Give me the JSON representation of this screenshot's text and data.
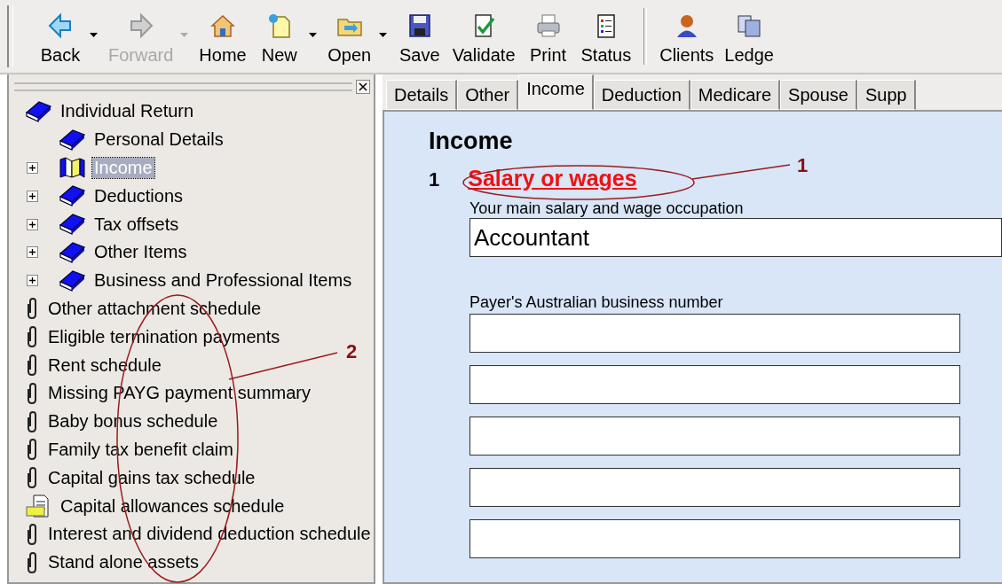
{
  "toolbar": [
    {
      "label": "Back",
      "disabled": false,
      "dropdown": true
    },
    {
      "label": "Forward",
      "disabled": true,
      "dropdown": true
    },
    {
      "label": "Home",
      "disabled": false,
      "dropdown": false
    },
    {
      "label": "New",
      "disabled": false,
      "dropdown": true
    },
    {
      "label": "Open",
      "disabled": false,
      "dropdown": true
    },
    {
      "label": "Save",
      "disabled": false,
      "dropdown": false
    },
    {
      "label": "Validate",
      "disabled": false,
      "dropdown": false
    },
    {
      "label": "Print",
      "disabled": false,
      "dropdown": false
    },
    {
      "label": "Status",
      "disabled": false,
      "dropdown": false,
      "separator_after": true
    },
    {
      "label": "Clients",
      "disabled": false,
      "dropdown": false
    },
    {
      "label": "Ledge",
      "disabled": false,
      "dropdown": false
    }
  ],
  "tree": [
    {
      "label": "Individual Return",
      "kind": "book",
      "selected": false,
      "expandable": false,
      "children": [
        {
          "label": "Personal Details",
          "kind": "book",
          "selected": false,
          "expandable": false
        },
        {
          "label": "Income",
          "kind": "open-book",
          "selected": true,
          "expandable": true
        },
        {
          "label": "Deductions",
          "kind": "book",
          "selected": false,
          "expandable": true
        },
        {
          "label": "Tax offsets",
          "kind": "book",
          "selected": false,
          "expandable": true
        },
        {
          "label": "Other Items",
          "kind": "book",
          "selected": false,
          "expandable": true
        },
        {
          "label": "Business and Professional Items",
          "kind": "book",
          "selected": false,
          "expandable": true
        }
      ]
    },
    {
      "label": "Other attachment schedule",
      "kind": "clip",
      "selected": false,
      "expandable": false
    },
    {
      "label": "Eligible termination payments",
      "kind": "clip",
      "selected": false,
      "expandable": false
    },
    {
      "label": "Rent schedule",
      "kind": "clip",
      "selected": false,
      "expandable": false
    },
    {
      "label": "Missing PAYG payment summary",
      "kind": "clip",
      "selected": false,
      "expandable": false
    },
    {
      "label": "Baby bonus schedule",
      "kind": "clip",
      "selected": false,
      "expandable": false
    },
    {
      "label": "Family tax benefit claim",
      "kind": "clip",
      "selected": false,
      "expandable": false
    },
    {
      "label": "Capital gains tax schedule",
      "kind": "clip",
      "selected": false,
      "expandable": false
    },
    {
      "label": "Capital allowances schedule",
      "kind": "document",
      "selected": false,
      "expandable": false
    },
    {
      "label": "Interest and dividend deduction schedule",
      "kind": "clip",
      "selected": false,
      "expandable": false
    },
    {
      "label": "Stand alone assets",
      "kind": "clip",
      "selected": false,
      "expandable": false
    }
  ],
  "tabs": [
    {
      "label": "Details",
      "selected": false
    },
    {
      "label": "Other",
      "selected": false
    },
    {
      "label": "Income",
      "selected": true
    },
    {
      "label": "Deduction",
      "selected": false
    },
    {
      "label": "Medicare",
      "selected": false
    },
    {
      "label": "Spouse",
      "selected": false
    },
    {
      "label": "Supp",
      "selected": false
    }
  ],
  "form": {
    "heading": "Income",
    "question_number": "1",
    "question_link": "Salary or wages",
    "occupation_label": "Your main salary and wage occupation",
    "occupation_value": "Accountant",
    "abn_label": "Payer's Australian business number",
    "abn_fields": [
      {
        "kind": "input"
      },
      {
        "kind": "input"
      },
      {
        "kind": "input"
      },
      {
        "kind": "input"
      },
      {
        "kind": "input"
      }
    ]
  },
  "annotations": [
    {
      "label": "1"
    },
    {
      "label": "2"
    }
  ]
}
